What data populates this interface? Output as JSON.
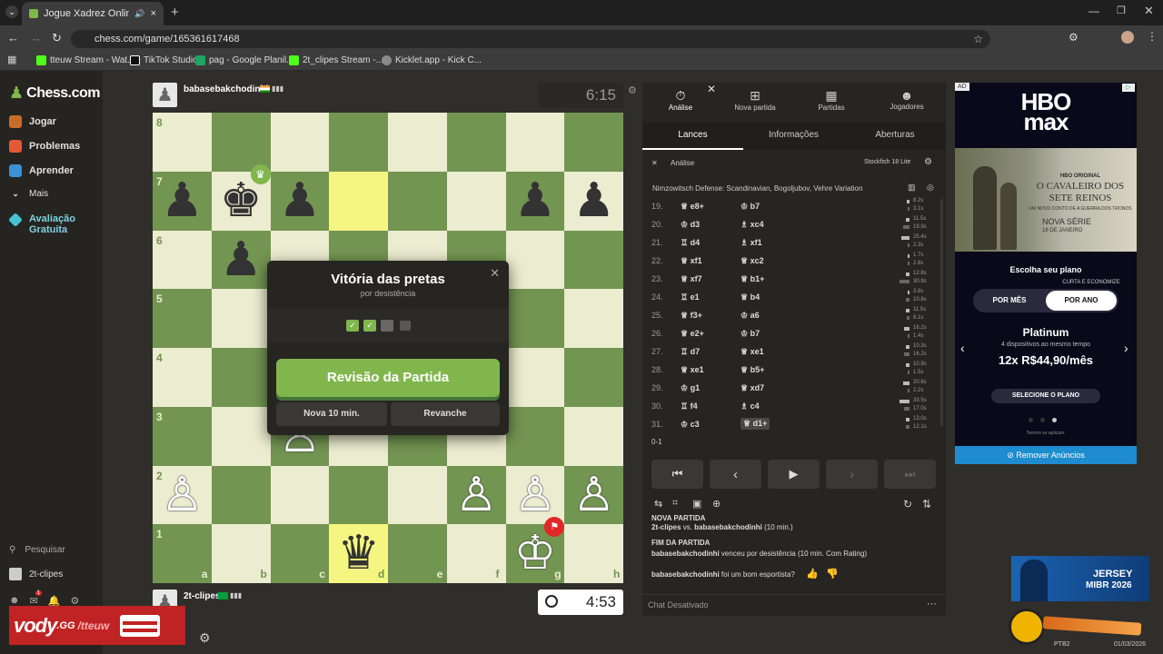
{
  "browser": {
    "tab_title": "Jogue Xadrez Online de GR",
    "url": "chess.com/game/165361617468",
    "bookmarks": [
      "tteuw Stream - Wat...",
      "TikTok Studio",
      "pag - Google Planil...",
      "2t_clipes Stream -...",
      "Kicklet.app - Kick C..."
    ]
  },
  "sidebar": {
    "logo": "Chess.com",
    "items": [
      "Jogar",
      "Problemas",
      "Aprender",
      "Mais",
      "Avaliação Gratuita"
    ],
    "search": "Pesquisar",
    "user": "2t-clipes",
    "notif_count": "1"
  },
  "players": {
    "top": "babasebakchodinhi",
    "top_clock": "6:15",
    "bottom": "2t-clipes",
    "bottom_clock": "4:53"
  },
  "board": {
    "ranks": [
      "8",
      "7",
      "6",
      "5",
      "4",
      "3",
      "2",
      "1"
    ],
    "files": [
      "a",
      "b",
      "c",
      "d",
      "e",
      "f",
      "g",
      "h"
    ]
  },
  "modal": {
    "title": "Vitória das pretas",
    "subtitle": "por desistência",
    "review": "Revisão da Partida",
    "new_game": "Nova 10 min.",
    "rematch": "Revanche"
  },
  "panel": {
    "tabs": [
      "Análise",
      "Nova partida",
      "Partidas",
      "Jogadores"
    ],
    "subtabs": [
      "Lances",
      "Informações",
      "Aberturas"
    ],
    "analysis_label": "Análise",
    "engine": "Stockfish 18 Lite",
    "opening": "Nimzowitsch Defense: Scandinavian, Bogoljubov, Vehre Variation",
    "moves": [
      {
        "n": "19.",
        "w": "e8+",
        "b": "b7",
        "tw": "8.2s",
        "tb": "3.1s"
      },
      {
        "n": "20.",
        "w": "d3",
        "b": "xc4",
        "tw": "11.5s",
        "tb": "19.9s"
      },
      {
        "n": "21.",
        "w": "d4",
        "b": "xf1",
        "tw": "25.4s",
        "tb": "2.3s"
      },
      {
        "n": "22.",
        "w": "xf1",
        "b": "xc2",
        "tw": "1.7s",
        "tb": "2.8s"
      },
      {
        "n": "23.",
        "w": "xf7",
        "b": "b1+",
        "tw": "12.8s",
        "tb": "30.9s"
      },
      {
        "n": "24.",
        "w": "e1",
        "b": "b4",
        "tw": "3.8s",
        "tb": "10.8s"
      },
      {
        "n": "25.",
        "w": "f3+",
        "b": "a6",
        "tw": "11.5s",
        "tb": "8.1s"
      },
      {
        "n": "26.",
        "w": "e2+",
        "b": "b7",
        "tw": "16.2s",
        "tb": "1.4s"
      },
      {
        "n": "27.",
        "w": "d7",
        "b": "xe1",
        "tw": "10.3s",
        "tb": "16.2s"
      },
      {
        "n": "28.",
        "w": "xe1",
        "b": "b5+",
        "tw": "10.9s",
        "tb": "1.5s"
      },
      {
        "n": "29.",
        "w": "g1",
        "b": "xd7",
        "tw": "20.6s",
        "tb": "2.2s"
      },
      {
        "n": "30.",
        "w": "f4",
        "b": "c4",
        "tw": "33.5s",
        "tb": "17.0s"
      },
      {
        "n": "31.",
        "w": "c3",
        "b": "d1+",
        "tw": "13.0s",
        "tb": "12.1s"
      }
    ],
    "result": "0-1",
    "log": {
      "h1": "NOVA PARTIDA",
      "l1_a": "2t-clipes",
      "l1_vs": "vs.",
      "l1_b": "babasebakchodinhi",
      "l1_c": "(10 min.)",
      "h2": "FIM DA PARTIDA",
      "l2_a": "babasebakchodinhi",
      "l2_b": "venceu por desistência (10 min. Com Rating)",
      "l3_a": "babasebakchodinhi",
      "l3_b": "foi um bom esportista?"
    },
    "chat": "Chat Desativado"
  },
  "ad": {
    "tag": "AD",
    "brand1": "HBO",
    "brand2": "max",
    "show_original": "HBO ORIGINAL",
    "show_title": "O CAVALEIRO DOS SETE REINOS",
    "show_sub": "UM NOVO CONTO DE A GUERRA DOS TRONOS",
    "show_date1": "NOVA SÉRIE",
    "show_date2": "18 DE JANEIRO",
    "plan_heading": "Escolha seu plano",
    "plan_note": "CURTA E ECONOMIZE",
    "toggle_month": "POR MÊS",
    "toggle_year": "POR ANO",
    "plan_name": "Platinum",
    "plan_desc": "4 dispositivos ao mesmo tempo",
    "price": "12x R$44,90/mês",
    "cta": "SELECIONE O PLANO",
    "terms": "Termos se aplicam.",
    "remove": "Remover Anúncios"
  },
  "overlay": {
    "vody": "vody",
    "gg": ".GG",
    "user": "/tteuw",
    "promo1": "JERSEY",
    "promo2": "MIBR 2026",
    "taskbar_date": "01/03/2026",
    "taskbar_lang": "PTB2"
  }
}
